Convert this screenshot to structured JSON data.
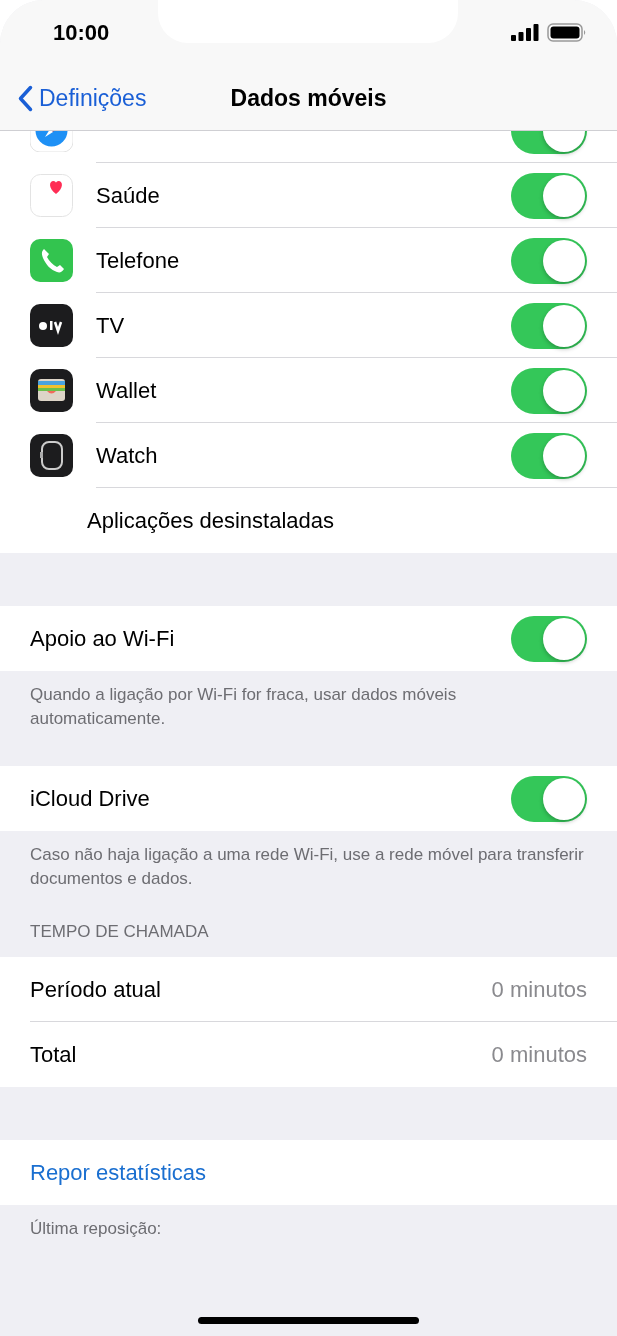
{
  "status_bar": {
    "time": "10:00"
  },
  "nav": {
    "back": "Definições",
    "title": "Dados móveis"
  },
  "apps": [
    {
      "kind": "safari",
      "on": true
    },
    {
      "name": "Saúde",
      "kind": "health",
      "on": true
    },
    {
      "name": "Telefone",
      "kind": "phone",
      "on": true
    },
    {
      "name": "TV",
      "kind": "tv",
      "on": true
    },
    {
      "name": "Wallet",
      "kind": "wallet",
      "on": true
    },
    {
      "name": "Watch",
      "kind": "watch",
      "on": true
    }
  ],
  "uninstalled": "Aplicações desinstaladas",
  "wifi_assist": {
    "label": "Apoio ao Wi-Fi",
    "on": true,
    "footer": "Quando a ligação por Wi-Fi for fraca, usar dados móveis automaticamente."
  },
  "icloud": {
    "label": "iCloud Drive",
    "on": true,
    "footer": "Caso não haja ligação a uma rede Wi-Fi, use a rede móvel para transferir documentos e dados."
  },
  "call_time": {
    "header": "TEMPO DE CHAMADA",
    "rows": [
      {
        "label": "Período atual",
        "value": "0 minutos"
      },
      {
        "label": "Total",
        "value": "0 minutos"
      }
    ]
  },
  "reset": {
    "label": "Repor estatísticas",
    "footer": "Última reposição:"
  }
}
